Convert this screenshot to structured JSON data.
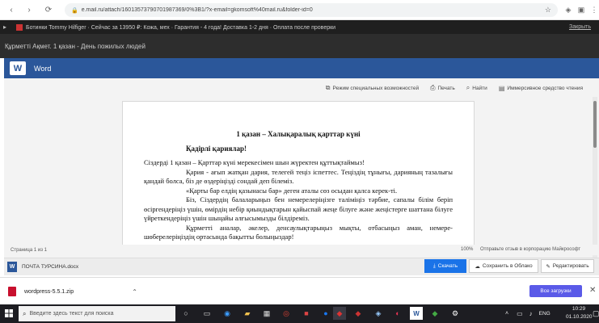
{
  "browser": {
    "url": "e.mail.ru/attach/16013573790701987369/0%3B1/?x-email=gkomsoft%40mail.ru&folder-id=0",
    "nav_back": "‹",
    "nav_forward": "›",
    "nav_reload": "⟳"
  },
  "promo": {
    "text": "Ботинки Tommy Hilfiger · Сейчас за 13950 ₽: Кожа, мех · Гарантия - 4 года! Доставка 1-2 дня · Оплата после проверки",
    "close": "Закрыть"
  },
  "mail": {
    "title": "Құрметті Ақмет. 1 қазан - День пожилых людей"
  },
  "word": {
    "app_name": "Word",
    "logo_letter": "W"
  },
  "toolbar": {
    "accessibility": "Режим специальных возможностей",
    "print": "Печать",
    "find": "Найти",
    "reading": "Иммерсивное средство чтения"
  },
  "document": {
    "title": "1 қазан – Халықаралық қарттар күні",
    "greeting": "Қадірлі қариялар!",
    "p1": "Сіздерді 1 қазан – Қарттар күні мерекесімен шын жүректен құттықтаймыз!",
    "p2": "Қария - ағып жатқан дария, телегей теңіз іспеттес. Теңіздің тұнығы, дарияның тазалығы қандай болса, біз де өздеріңізді сондай деп білеміз.",
    "p3": "«Қарты бар елдің қазынасы бар» деген аталы сөз осыдан қалса керек-ті.",
    "p4": "Біз, Сіздердің балаларыңыз бен немерелеріңізге таліміңіз тәрбие, сапалы білім беріп өсіргендеріңіз үшін, өмірдің небір қиындықтарын қайыспай жеңе білуге және жеңістерге шаттана білуге үйреткендеріңіз үшін шыңайы алғысымызды білдіреміз.",
    "p5": "Құрметті аналар, әкелер, денсаулықтарыңыз мықты, отбасыңыз аман, немере-шөберелеріңіздің ортасында бақытты болыңыздар!"
  },
  "status": {
    "page": "Страница 1 из 1",
    "zoom": "100%",
    "help": "Отправьте отзыв в корпорацию Майкрософт"
  },
  "attachment": {
    "name": "ПОЧТА ТУРСИНА.docx",
    "download": "Скачать",
    "save_cloud": "Сохранить в Облако",
    "edit": "Редактировать"
  },
  "downloads": {
    "file": "wordpress-5.5.1.zip",
    "show_all": "Все загрузки"
  },
  "taskbar": {
    "search_placeholder": "Введите здесь текст для поиска",
    "lang": "ENG",
    "time": "10:29",
    "date": "01.10.2020"
  }
}
